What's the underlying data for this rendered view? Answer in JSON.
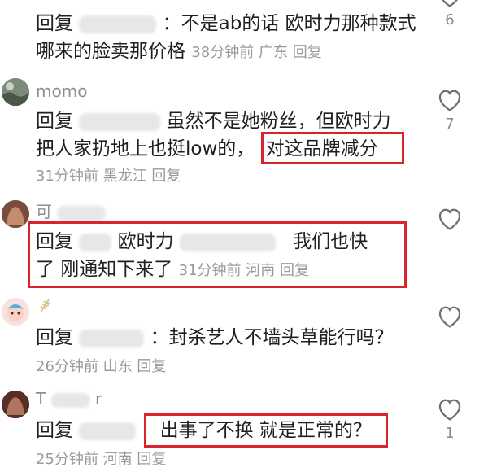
{
  "comments": [
    {
      "reply_prefix": "回复",
      "text": "：不是ab的话 欧时力那种款式",
      "text2": "哪来的脸卖那价格",
      "time": "38分钟前",
      "location": "广东",
      "reply_btn": "回复",
      "likes": "6"
    },
    {
      "username": "momo",
      "reply_prefix": "回复",
      "text": "虽然不是她粉丝，但欧时力",
      "text2a": "把人家扔地上也挺low的，",
      "text2b": "对这品牌减分",
      "time": "31分钟前",
      "location": "黑龙江",
      "reply_btn": "回复",
      "likes": "7"
    },
    {
      "username": "可",
      "reply_prefix": "回复",
      "text_a": "欧时力",
      "text_b": "我们也快",
      "text2": "了 刚通知下来了",
      "time": "31分钟前",
      "location": "河南",
      "reply_btn": "回复"
    },
    {
      "reply_prefix": "回复",
      "text": "：封杀艺人不墙头草能行吗？",
      "time": "26分钟前",
      "location": "山东",
      "reply_btn": "回复"
    },
    {
      "username": "T",
      "username_tail": "r",
      "reply_prefix": "回复",
      "text": "出事了不换 就是正常的？",
      "time": "25分钟前",
      "location": "河南",
      "reply_btn": "回复",
      "likes": "1"
    }
  ],
  "icons": {
    "like": "heart-outline-icon"
  },
  "colors": {
    "highlight": "#d9232d",
    "meta": "#9a9a9a"
  }
}
